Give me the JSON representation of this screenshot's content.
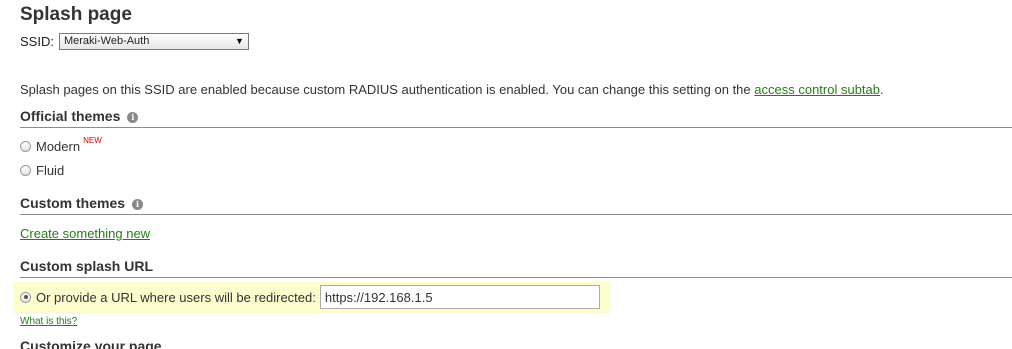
{
  "page": {
    "title": "Splash page"
  },
  "ssid": {
    "label": "SSID:",
    "selected": "Meraki-Web-Auth"
  },
  "notice": {
    "text": "Splash pages on this SSID are enabled because custom RADIUS authentication is enabled. You can change this setting on the ",
    "link": "access control subtab",
    "end": "."
  },
  "official_themes": {
    "title": "Official themes",
    "options": [
      {
        "label": "Modern",
        "badge": "NEW",
        "checked": false
      },
      {
        "label": "Fluid",
        "checked": false
      }
    ]
  },
  "custom_themes": {
    "title": "Custom themes",
    "create_link": "Create something new"
  },
  "custom_splash_url": {
    "title": "Custom splash URL",
    "radio_label": "Or provide a URL where users will be redirected:",
    "url_value": "https://192.168.1.5",
    "help_link": "What is this?",
    "highlight_color": "#fdfdce"
  },
  "customize": {
    "title": "Customize your page"
  },
  "colors": {
    "link": "#2a7a1c",
    "new_badge": "#d40000"
  }
}
